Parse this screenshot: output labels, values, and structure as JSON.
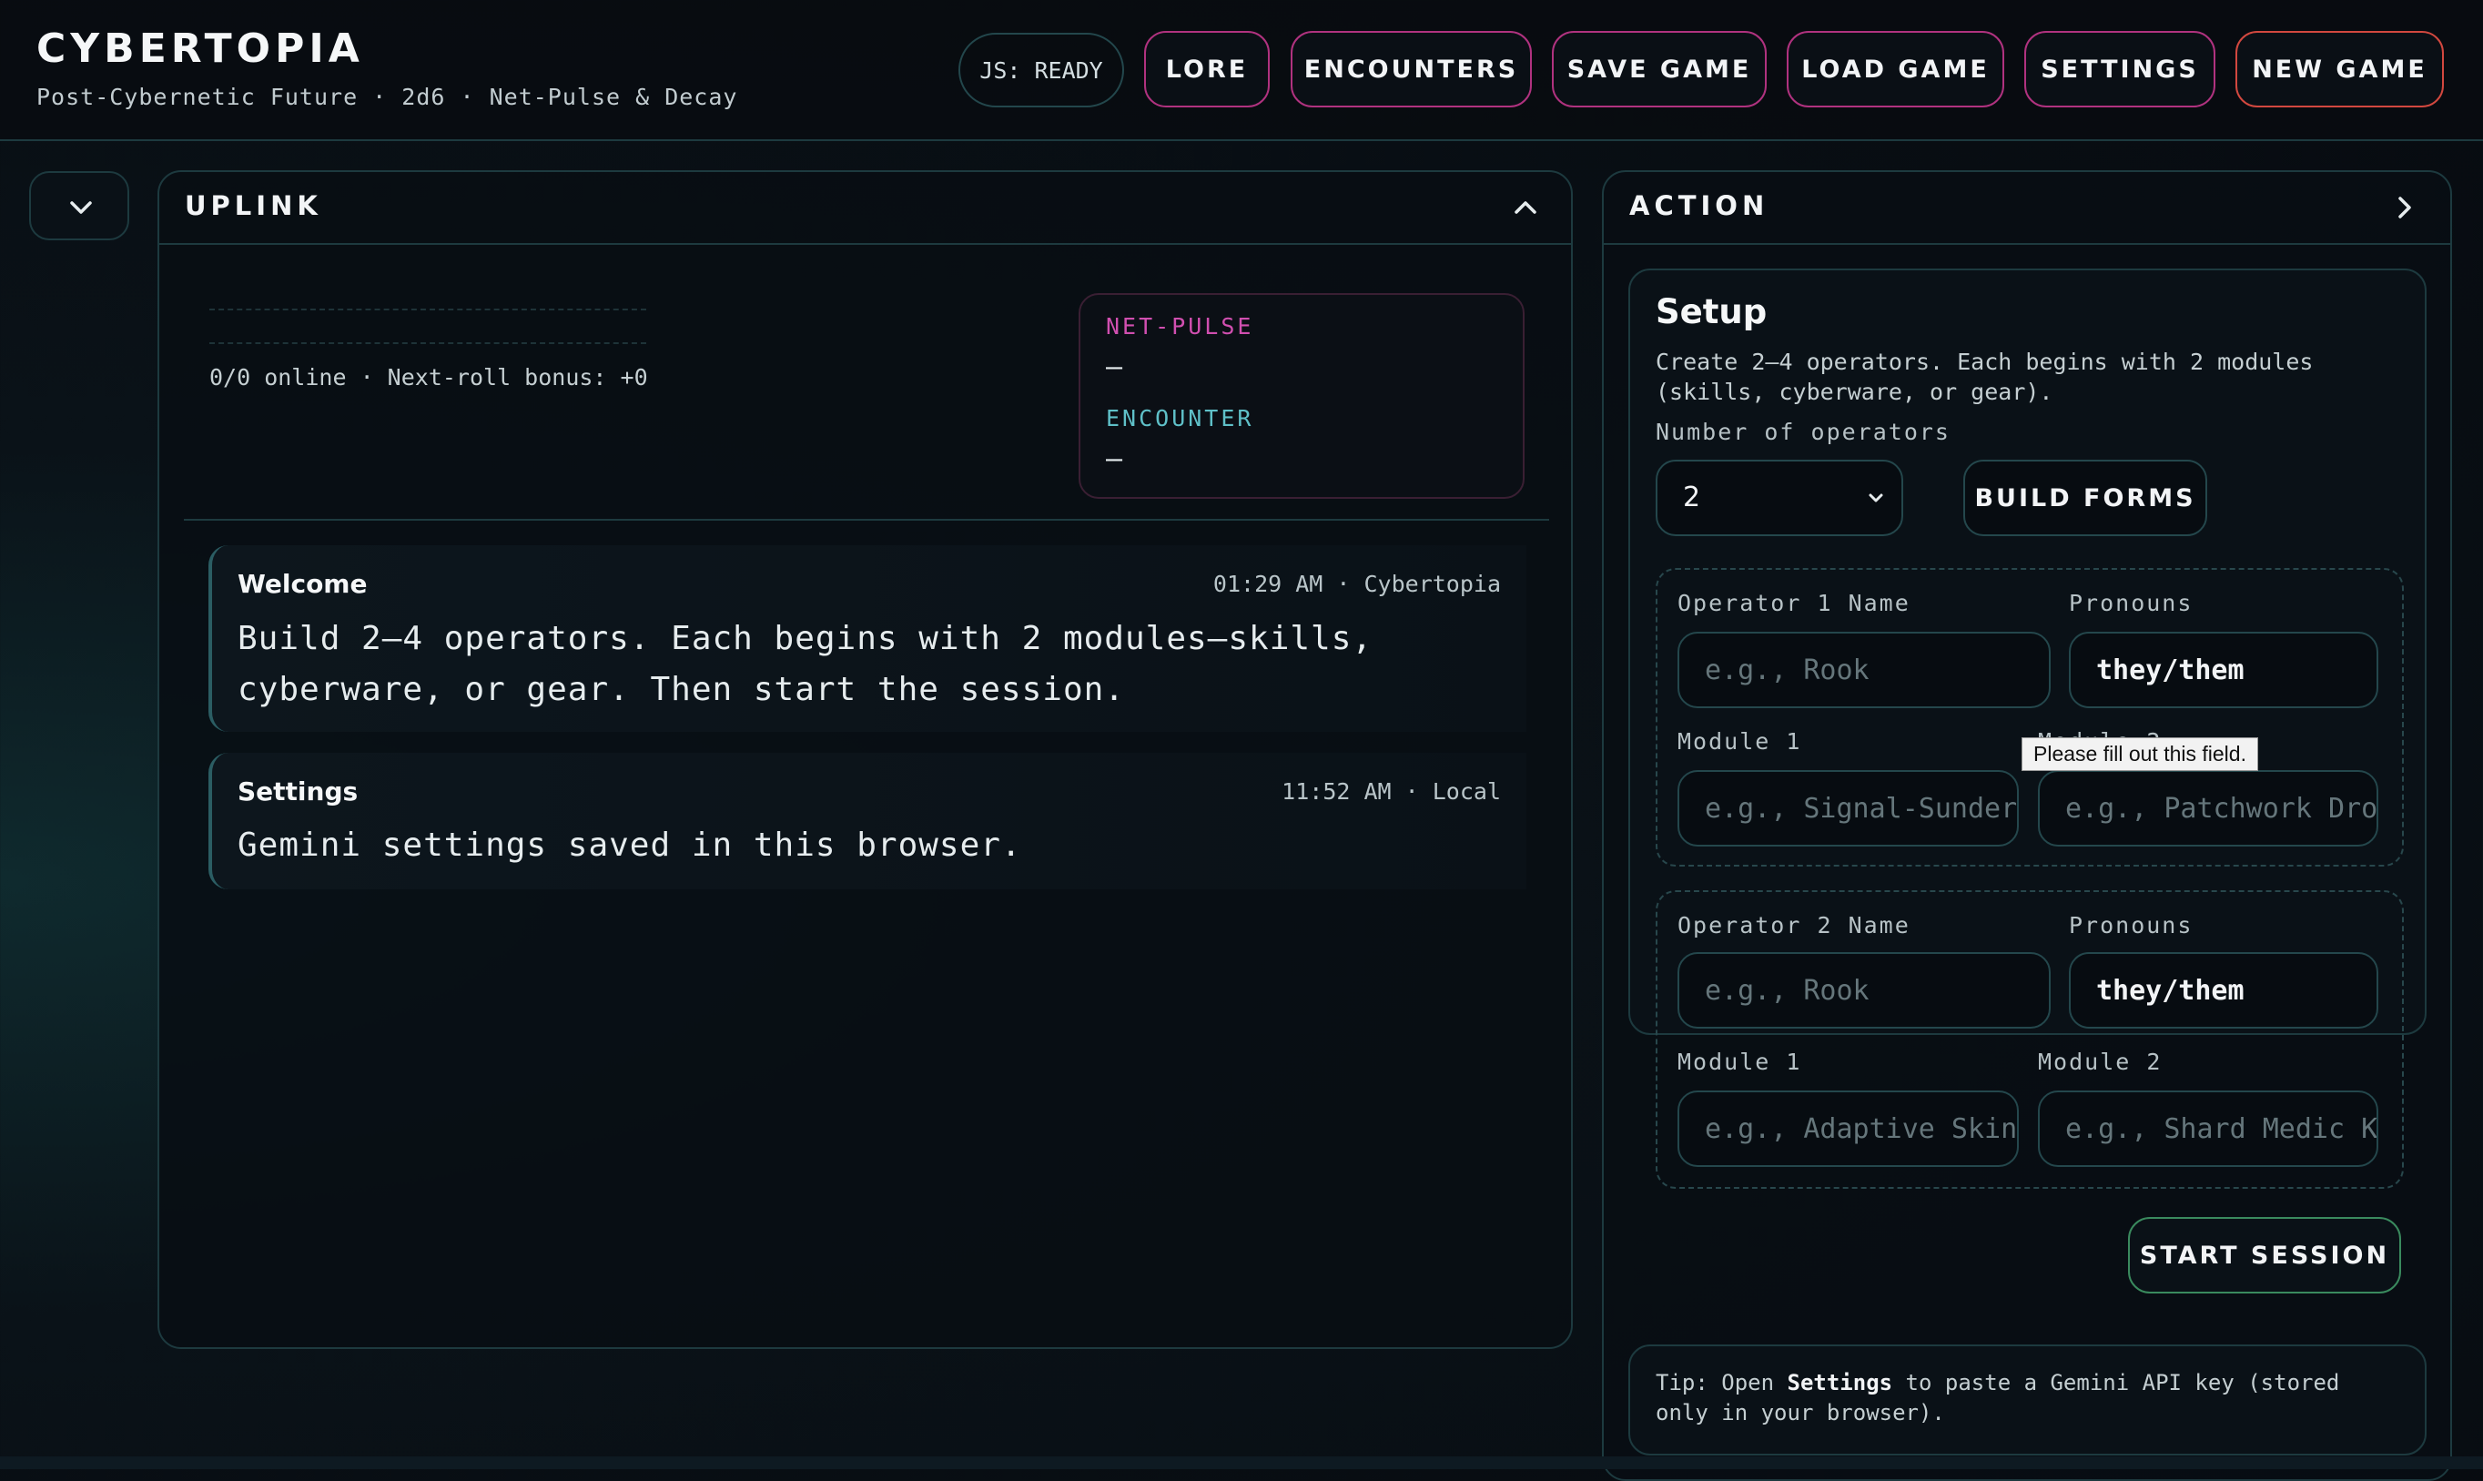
{
  "app": {
    "title": "CYBERTOPIA",
    "subtitle": "Post-Cybernetic Future · 2d6 · Net-Pulse & Decay"
  },
  "header": {
    "status_badge": "JS: READY",
    "buttons": {
      "lore": "LORE",
      "encounters": "ENCOUNTERS",
      "save": "SAVE GAME",
      "load": "LOAD GAME",
      "settings": "SETTINGS",
      "new_game": "NEW GAME"
    }
  },
  "uplink": {
    "title": "UPLINK",
    "online_status": "0/0 online · Next-roll bonus: +0",
    "net_pulse": {
      "label": "NET-PULSE",
      "value": "—"
    },
    "encounter": {
      "label": "ENCOUNTER",
      "value": "—"
    },
    "messages": [
      {
        "title": "Welcome",
        "meta": "01:29 AM · Cybertopia",
        "text": "Build 2–4 operators. Each begins with 2 modules—skills, cyberware, or gear. Then start the session."
      },
      {
        "title": "Settings",
        "meta": "11:52 AM · Local",
        "text": "Gemini settings saved in this browser."
      }
    ]
  },
  "action": {
    "title": "ACTION",
    "setup": {
      "title": "Setup",
      "description": "Create 2–4 operators. Each begins with 2 modules (skills, cyberware, or gear).",
      "count_label": "Number of operators",
      "count_value": "2",
      "build_forms": "BUILD FORMS",
      "operators": [
        {
          "name_label": "Operator 1 Name",
          "name_placeholder": "e.g., Rook",
          "pronouns_label": "Pronouns",
          "pronouns_value": "they/them",
          "module1_label": "Module 1",
          "module1_placeholder": "e.g., Signal-Sunder",
          "module2_label": "Module 2",
          "module2_placeholder": "e.g., Patchwork Drone"
        },
        {
          "name_label": "Operator 2 Name",
          "name_placeholder": "e.g., Rook",
          "pronouns_label": "Pronouns",
          "pronouns_value": "they/them",
          "module1_label": "Module 1",
          "module1_placeholder": "e.g., Adaptive Skin",
          "module2_label": "Module 2",
          "module2_placeholder": "e.g., Shard Medic Kit"
        }
      ],
      "tooltip": "Please fill out this field.",
      "start_session": "START SESSION"
    },
    "tip": {
      "prefix": "Tip: Open ",
      "keyword": "Settings",
      "suffix": " to paste a Gemini API key (stored only in your browser)."
    }
  },
  "colors": {
    "accent_magenta": "#c2328a",
    "accent_red": "#d2483f",
    "accent_green": "#3a8a5e",
    "net_pulse": "#d14fb0",
    "encounter": "#5fc0c8"
  }
}
